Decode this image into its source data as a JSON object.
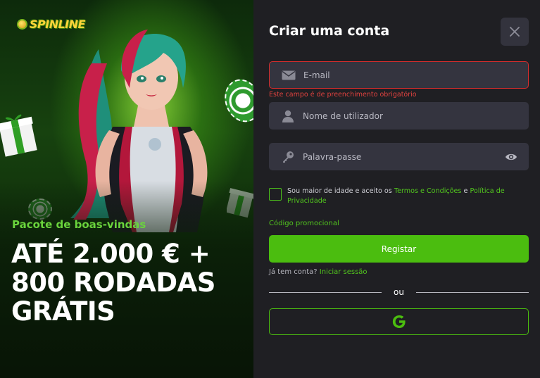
{
  "brand": {
    "logo_text": "SPINLINE"
  },
  "promo": {
    "subtitle": "Pacote de boas-vindas",
    "title_lines": [
      "ATÉ 2.000 € +",
      "800 RODADAS",
      "GRÁTIS"
    ]
  },
  "form": {
    "title": "Criar uma conta",
    "email": {
      "placeholder": "E-mail",
      "value": "",
      "error": "Este campo é de preenchimento obrigatório"
    },
    "username": {
      "placeholder": "Nome de utilizador",
      "value": ""
    },
    "password": {
      "placeholder": "Palavra-passe",
      "value": ""
    },
    "consent": {
      "text_before": "Sou maior de idade e aceito os ",
      "terms_link": "Termos e Condições",
      "text_middle": " e ",
      "privacy_link": "Política de Privacidade",
      "checked": false
    },
    "promo_code_link": "Código promocional",
    "submit_label": "Registar",
    "login_prompt": "Já tem conta? ",
    "login_link": "Iniciar sessão",
    "divider_label": "ou"
  },
  "icons": {
    "close": "close-icon",
    "email": "envelope-icon",
    "user": "user-icon",
    "key": "key-icon",
    "eye": "eye-icon",
    "google": "google-icon"
  },
  "colors": {
    "accent": "#4bbd0f",
    "error": "#d52d2d",
    "background": "#1f1f23",
    "field": "#34343f"
  }
}
